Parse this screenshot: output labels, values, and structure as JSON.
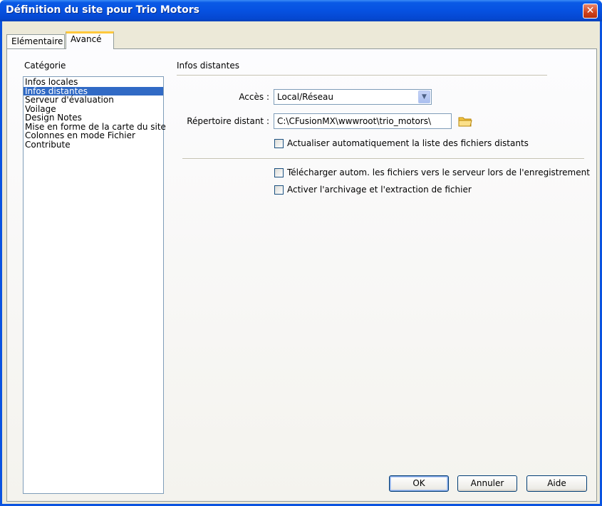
{
  "window": {
    "title": "Définition du site pour Trio Motors",
    "close_label": "✕"
  },
  "tabs": [
    {
      "label": "Elémentaire",
      "active": false
    },
    {
      "label": "Avancé",
      "active": true
    }
  ],
  "category": {
    "label": "Catégorie",
    "items": [
      {
        "label": "Infos locales",
        "selected": false
      },
      {
        "label": "Infos distantes",
        "selected": true
      },
      {
        "label": "Serveur d'évaluation",
        "selected": false
      },
      {
        "label": "Voilage",
        "selected": false
      },
      {
        "label": "Design Notes",
        "selected": false
      },
      {
        "label": "Mise en forme de la carte du site",
        "selected": false
      },
      {
        "label": "Colonnes en mode Fichier",
        "selected": false
      },
      {
        "label": "Contribute",
        "selected": false
      }
    ]
  },
  "section": {
    "title": "Infos distantes",
    "access_label": "Accès :",
    "access_value": "Local/Réseau",
    "remote_dir_label": "Répertoire distant :",
    "remote_dir_value": "C:\\CFusionMX\\wwwroot\\trio_motors\\",
    "checkboxes": [
      {
        "label": "Actualiser automatiquement la liste des fichiers distants",
        "checked": false
      },
      {
        "label": "Télécharger autom. les fichiers vers le serveur lors de l'enregistrement",
        "checked": false
      },
      {
        "label": "Activer l'archivage et l'extraction de fichier",
        "checked": false
      }
    ]
  },
  "buttons": {
    "ok": "OK",
    "cancel": "Annuler",
    "help": "Aide"
  },
  "icons": {
    "folder": "folder-icon",
    "dropdown": "chevron-down-icon",
    "close": "close-icon"
  },
  "colors": {
    "titlebar": "#0a5ae6",
    "selection": "#316ac5",
    "tab_highlight": "#ffc83c",
    "close_button": "#d0421c"
  }
}
